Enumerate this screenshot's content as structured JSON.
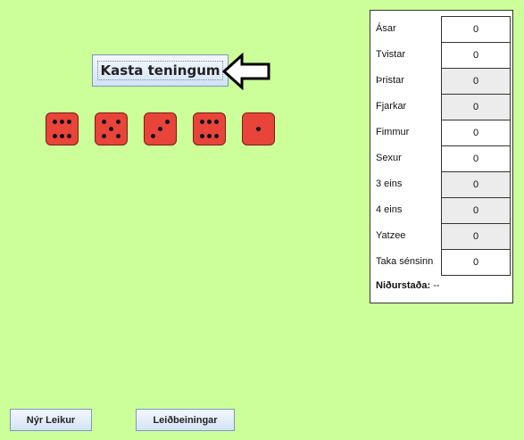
{
  "roll_button_label": "Kasta teningum",
  "dice": [
    6,
    5,
    3,
    6,
    1
  ],
  "scores": [
    {
      "label": "Ásar",
      "value": "0",
      "filled": true
    },
    {
      "label": "Tvistar",
      "value": "0",
      "filled": true
    },
    {
      "label": "Þristar",
      "value": "0",
      "filled": false
    },
    {
      "label": "Fjarkar",
      "value": "0",
      "filled": false
    },
    {
      "label": "Fimmur",
      "value": "0",
      "filled": true
    },
    {
      "label": "Sexur",
      "value": "0",
      "filled": true
    },
    {
      "label": "3 eins",
      "value": "0",
      "filled": false
    },
    {
      "label": "4 eins",
      "value": "0",
      "filled": false
    },
    {
      "label": "Yatzee",
      "value": "0",
      "filled": false
    },
    {
      "label": "Taka sénsinn",
      "value": "0",
      "filled": true
    }
  ],
  "result": {
    "label": "Niðurstaða:",
    "value": "--"
  },
  "buttons": {
    "new_game": "Nýr Leikur",
    "instructions": "Leiðbeiningar"
  },
  "colors": {
    "background": "#ccff99",
    "die_face": "#e8443a",
    "pip": "#111111",
    "empty_cell": "#ececec"
  },
  "icons": {
    "pointer": "hollow-arrow-left-icon"
  }
}
